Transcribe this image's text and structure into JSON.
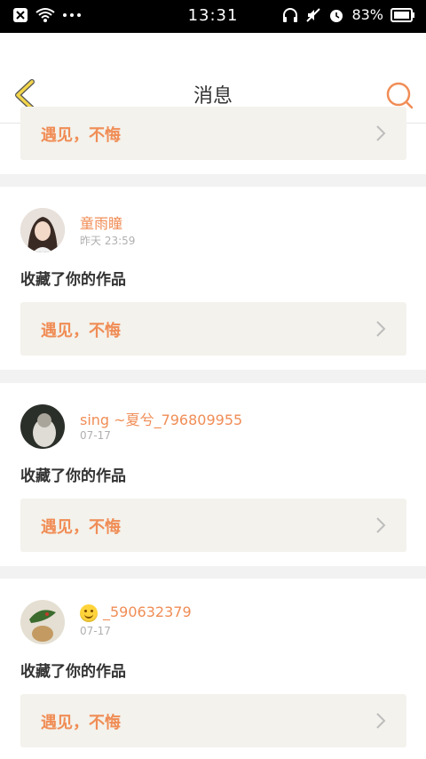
{
  "status_bar": {
    "time": "13:31",
    "battery": "83%"
  },
  "header": {
    "title": "消息"
  },
  "link_label": "遇见，不悔",
  "items": [
    {
      "name": "童雨瞳",
      "time": "昨天 23:59",
      "message": "收藏了你的作品"
    },
    {
      "name": "sing ~夏兮_796809955",
      "time": "07-17",
      "message": "收藏了你的作品"
    },
    {
      "name": "_590632379",
      "time": "07-17",
      "message": "收藏了你的作品"
    }
  ],
  "colors": {
    "accent": "#f08d56",
    "back_icon": "#f2d54a",
    "card_link_bg": "#f3f2ec"
  }
}
